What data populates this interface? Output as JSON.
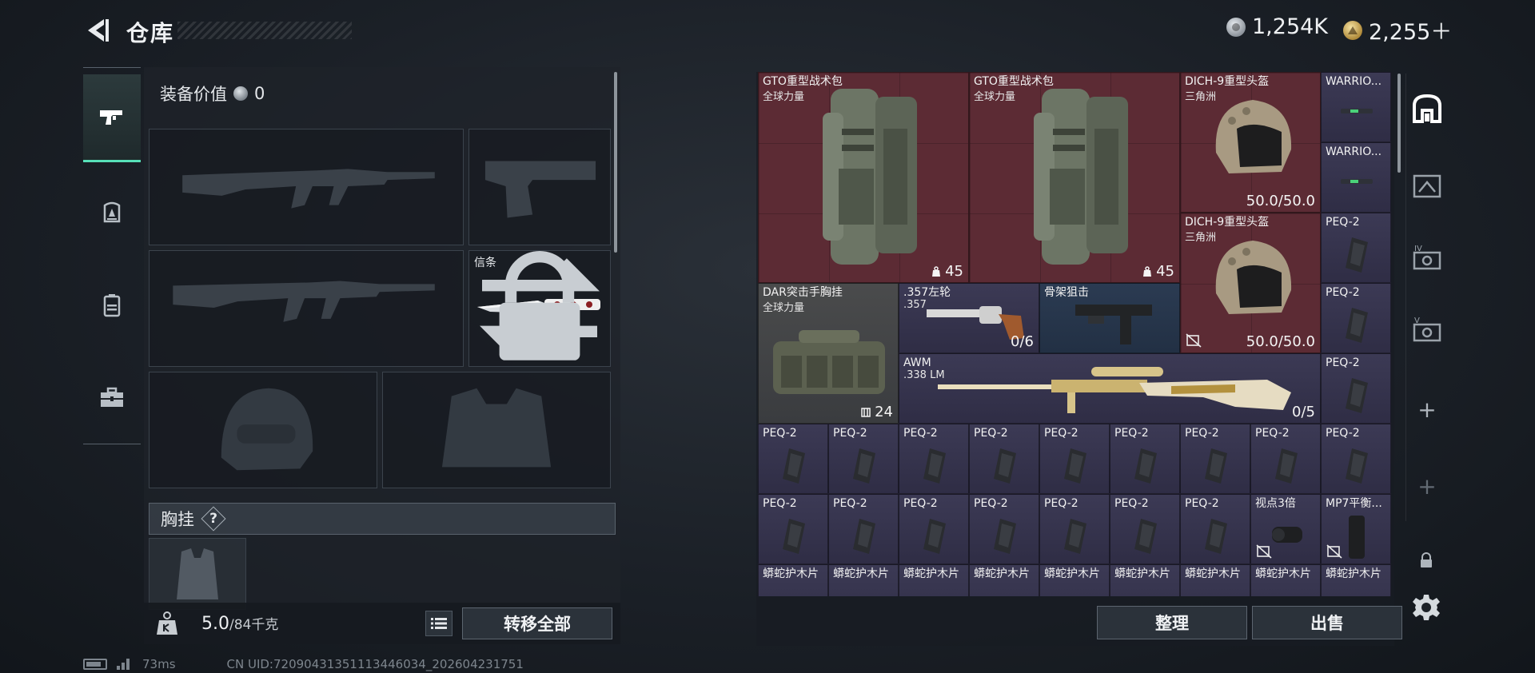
{
  "header": {
    "title": "仓库",
    "currency": [
      {
        "name": "coin-silver",
        "value": "1,254K"
      },
      {
        "name": "coin-gold",
        "value": "2,255＋"
      }
    ]
  },
  "loadout": {
    "equip_value_label": "装备价值",
    "equip_value": "0",
    "melee_slot_label": "信条",
    "chest_rig_label": "胸挂",
    "help_label": "?",
    "weight_value": "5.0",
    "weight_max": "/84千克",
    "transfer_all_label": "转移全部"
  },
  "storage": {
    "items": [
      {
        "name": "GTO重型战术包",
        "sub": "全球力量",
        "qty": "45"
      },
      {
        "name": "GTO重型战术包",
        "sub": "全球力量",
        "qty": "45"
      },
      {
        "name": "DICH-9重型头盔",
        "sub": "三角洲",
        "qty": "50.0/50.0"
      },
      {
        "name": "DICH-9重型头盔",
        "sub": "三角洲",
        "qty": "50.0/50.0"
      },
      {
        "name": "WARRIO...",
        "sub": "",
        "qty": ""
      },
      {
        "name": "WARRIO...",
        "sub": "",
        "qty": ""
      },
      {
        "name": "DAR突击手胸挂",
        "sub": "全球力量",
        "qty": "24"
      },
      {
        "name": ".357左轮",
        "sub": ".357",
        "qty": "0/6"
      },
      {
        "name": "骨架狙击",
        "sub": "",
        "qty": ""
      },
      {
        "name": "AWM",
        "sub": ".338 LM",
        "qty": "0/5"
      },
      {
        "name": "视点3倍",
        "sub": "",
        "qty": ""
      },
      {
        "name": "MP7平衡...",
        "sub": "",
        "qty": ""
      }
    ],
    "peq_label": "PEQ-2",
    "plate_label": "蟒蛇护木片",
    "sort_label": "整理",
    "sell_label": "出售"
  },
  "footer": {
    "ping": "73ms",
    "uid": "CN UID:72090431351113446034_202604231751"
  },
  "colors": {
    "accent": "#57e0b8",
    "rarity_red": "#5c2b34",
    "rarity_purple": "#3a3852",
    "rarity_blue": "#2b3b52",
    "rarity_grey": "#3a3d42"
  }
}
